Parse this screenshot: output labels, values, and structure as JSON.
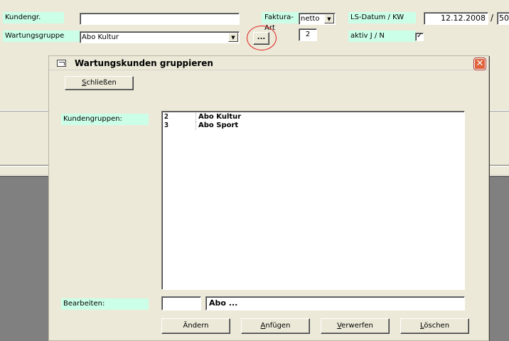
{
  "form": {
    "kundengr_label": "Kundengr.",
    "kundengr_value": "",
    "wartungsgruppe_label": "Wartungsgruppe",
    "wartungsgruppe_value": "Abo Kultur",
    "browse_button": "...",
    "faktura_label": "Faktura-Art",
    "faktura_value": "netto",
    "faktura_number": "2",
    "ls_datum_label": "LS-Datum / KW",
    "ls_datum_value": "12.12.2008",
    "slash": "/",
    "kw_value": "50",
    "aktiv_label": "aktiv  J / N",
    "aktiv_checked": true
  },
  "dialog": {
    "title": "Wartungskunden gruppieren",
    "close_label": "Schließen",
    "kundengruppen_label": "Kundengruppen:",
    "list": [
      {
        "id": "2",
        "name": "Abo Kultur"
      },
      {
        "id": "3",
        "name": "Abo Sport"
      }
    ],
    "bearbeiten_label": "Bearbeiten:",
    "edit_id": "",
    "edit_name": "Abo ...",
    "buttons": {
      "aendern": "Ändern",
      "anfuegen": "Anfügen",
      "verwerfen": "Verwerfen",
      "loeschen": "Löschen"
    }
  },
  "colors": {
    "label_bg": "#ccffe8",
    "highlight_circle": "#e02020",
    "close_button": "#e0623b"
  },
  "icons": {
    "dialog_icon": "window-icon",
    "close": "close-icon",
    "combo": "chevron-down-icon",
    "checkbox": "check-icon"
  }
}
